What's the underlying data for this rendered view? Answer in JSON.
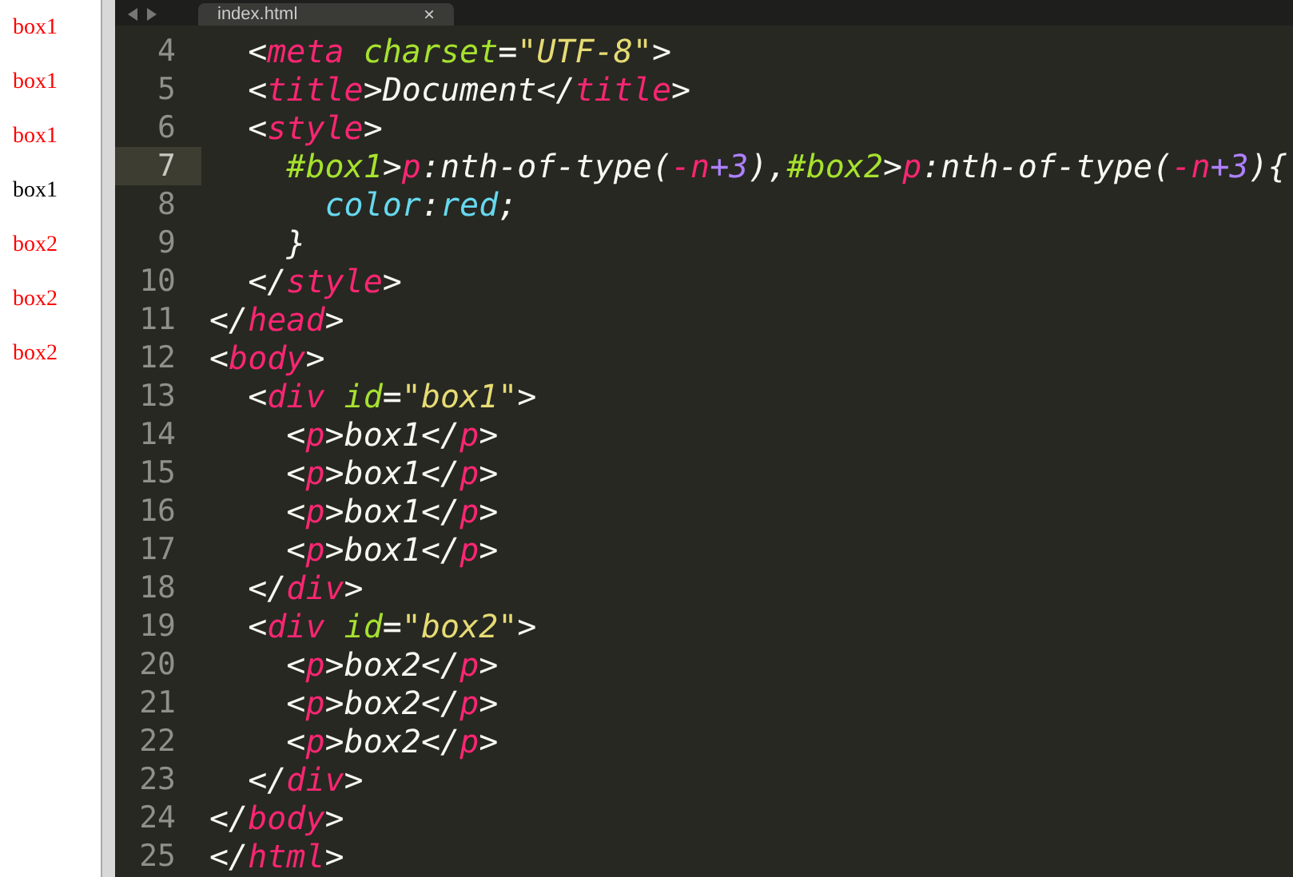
{
  "preview": {
    "paragraphs": [
      {
        "text": "box1",
        "color": "#ff0000"
      },
      {
        "text": "box1",
        "color": "#ff0000"
      },
      {
        "text": "box1",
        "color": "#ff0000"
      },
      {
        "text": "box1",
        "color": "#000000"
      },
      {
        "text": "box2",
        "color": "#ff0000"
      },
      {
        "text": "box2",
        "color": "#ff0000"
      },
      {
        "text": "box2",
        "color": "#ff0000"
      }
    ]
  },
  "editor": {
    "tab": {
      "label": "index.html",
      "close": "×"
    },
    "lines": [
      {
        "number": "4",
        "selected": false,
        "tokens": [
          {
            "kind": "punct",
            "text": "  <"
          },
          {
            "kind": "tag",
            "text": "meta"
          },
          {
            "kind": "attr",
            "text": " charset"
          },
          {
            "kind": "punct",
            "text": "="
          },
          {
            "kind": "string",
            "text": "\"UTF-8\""
          },
          {
            "kind": "punct",
            "text": ">"
          }
        ]
      },
      {
        "number": "5",
        "selected": false,
        "tokens": [
          {
            "kind": "punct",
            "text": "  <"
          },
          {
            "kind": "tag",
            "text": "title"
          },
          {
            "kind": "punct",
            "text": ">Document</"
          },
          {
            "kind": "tag",
            "text": "title"
          },
          {
            "kind": "punct",
            "text": ">"
          }
        ]
      },
      {
        "number": "6",
        "selected": false,
        "tokens": [
          {
            "kind": "punct",
            "text": "  <"
          },
          {
            "kind": "tag",
            "text": "style"
          },
          {
            "kind": "punct",
            "text": ">"
          }
        ]
      },
      {
        "number": "7",
        "selected": true,
        "tokens": [
          {
            "kind": "attr",
            "text": "    #box1"
          },
          {
            "kind": "punct",
            "text": ">"
          },
          {
            "kind": "tag",
            "text": "p"
          },
          {
            "kind": "punct",
            "text": ":nth-of-type("
          },
          {
            "kind": "tag",
            "text": "-n"
          },
          {
            "kind": "number",
            "text": "+3"
          },
          {
            "kind": "punct",
            "text": "),"
          },
          {
            "kind": "attr",
            "text": "#box2"
          },
          {
            "kind": "punct",
            "text": ">"
          },
          {
            "kind": "tag",
            "text": "p"
          },
          {
            "kind": "punct",
            "text": ":nth-of-type("
          },
          {
            "kind": "tag",
            "text": "-n"
          },
          {
            "kind": "number",
            "text": "+3"
          },
          {
            "kind": "punct",
            "text": "){"
          }
        ]
      },
      {
        "number": "8",
        "selected": false,
        "tokens": [
          {
            "kind": "property",
            "text": "      color"
          },
          {
            "kind": "punct",
            "text": ":"
          },
          {
            "kind": "property",
            "text": "red"
          },
          {
            "kind": "punct",
            "text": ";"
          }
        ]
      },
      {
        "number": "9",
        "selected": false,
        "tokens": [
          {
            "kind": "punct",
            "text": "    }"
          }
        ]
      },
      {
        "number": "10",
        "selected": false,
        "tokens": [
          {
            "kind": "punct",
            "text": "  </"
          },
          {
            "kind": "tag",
            "text": "style"
          },
          {
            "kind": "punct",
            "text": ">"
          }
        ]
      },
      {
        "number": "11",
        "selected": false,
        "tokens": [
          {
            "kind": "punct",
            "text": "</"
          },
          {
            "kind": "tag",
            "text": "head"
          },
          {
            "kind": "punct",
            "text": ">"
          }
        ]
      },
      {
        "number": "12",
        "selected": false,
        "tokens": [
          {
            "kind": "punct",
            "text": "<"
          },
          {
            "kind": "tag",
            "text": "body"
          },
          {
            "kind": "punct",
            "text": ">"
          }
        ]
      },
      {
        "number": "13",
        "selected": false,
        "tokens": [
          {
            "kind": "punct",
            "text": "  <"
          },
          {
            "kind": "tag",
            "text": "div"
          },
          {
            "kind": "attr",
            "text": " id"
          },
          {
            "kind": "punct",
            "text": "="
          },
          {
            "kind": "string",
            "text": "\"box1\""
          },
          {
            "kind": "punct",
            "text": ">"
          }
        ]
      },
      {
        "number": "14",
        "selected": false,
        "tokens": [
          {
            "kind": "punct",
            "text": "    <"
          },
          {
            "kind": "tag",
            "text": "p"
          },
          {
            "kind": "punct",
            "text": ">box1</"
          },
          {
            "kind": "tag",
            "text": "p"
          },
          {
            "kind": "punct",
            "text": ">"
          }
        ]
      },
      {
        "number": "15",
        "selected": false,
        "tokens": [
          {
            "kind": "punct",
            "text": "    <"
          },
          {
            "kind": "tag",
            "text": "p"
          },
          {
            "kind": "punct",
            "text": ">box1</"
          },
          {
            "kind": "tag",
            "text": "p"
          },
          {
            "kind": "punct",
            "text": ">"
          }
        ]
      },
      {
        "number": "16",
        "selected": false,
        "tokens": [
          {
            "kind": "punct",
            "text": "    <"
          },
          {
            "kind": "tag",
            "text": "p"
          },
          {
            "kind": "punct",
            "text": ">box1</"
          },
          {
            "kind": "tag",
            "text": "p"
          },
          {
            "kind": "punct",
            "text": ">"
          }
        ]
      },
      {
        "number": "17",
        "selected": false,
        "tokens": [
          {
            "kind": "punct",
            "text": "    <"
          },
          {
            "kind": "tag",
            "text": "p"
          },
          {
            "kind": "punct",
            "text": ">box1</"
          },
          {
            "kind": "tag",
            "text": "p"
          },
          {
            "kind": "punct",
            "text": ">"
          }
        ]
      },
      {
        "number": "18",
        "selected": false,
        "tokens": [
          {
            "kind": "punct",
            "text": "  </"
          },
          {
            "kind": "tag",
            "text": "div"
          },
          {
            "kind": "punct",
            "text": ">"
          }
        ]
      },
      {
        "number": "19",
        "selected": false,
        "tokens": [
          {
            "kind": "punct",
            "text": "  <"
          },
          {
            "kind": "tag",
            "text": "div"
          },
          {
            "kind": "attr",
            "text": " id"
          },
          {
            "kind": "punct",
            "text": "="
          },
          {
            "kind": "string",
            "text": "\"box2\""
          },
          {
            "kind": "punct",
            "text": ">"
          }
        ]
      },
      {
        "number": "20",
        "selected": false,
        "tokens": [
          {
            "kind": "punct",
            "text": "    <"
          },
          {
            "kind": "tag",
            "text": "p"
          },
          {
            "kind": "punct",
            "text": ">box2</"
          },
          {
            "kind": "tag",
            "text": "p"
          },
          {
            "kind": "punct",
            "text": ">"
          }
        ]
      },
      {
        "number": "21",
        "selected": false,
        "tokens": [
          {
            "kind": "punct",
            "text": "    <"
          },
          {
            "kind": "tag",
            "text": "p"
          },
          {
            "kind": "punct",
            "text": ">box2</"
          },
          {
            "kind": "tag",
            "text": "p"
          },
          {
            "kind": "punct",
            "text": ">"
          }
        ]
      },
      {
        "number": "22",
        "selected": false,
        "tokens": [
          {
            "kind": "punct",
            "text": "    <"
          },
          {
            "kind": "tag",
            "text": "p"
          },
          {
            "kind": "punct",
            "text": ">box2</"
          },
          {
            "kind": "tag",
            "text": "p"
          },
          {
            "kind": "punct",
            "text": ">"
          }
        ]
      },
      {
        "number": "23",
        "selected": false,
        "tokens": [
          {
            "kind": "punct",
            "text": "  </"
          },
          {
            "kind": "tag",
            "text": "div"
          },
          {
            "kind": "punct",
            "text": ">"
          }
        ]
      },
      {
        "number": "24",
        "selected": false,
        "tokens": [
          {
            "kind": "punct",
            "text": "</"
          },
          {
            "kind": "tag",
            "text": "body"
          },
          {
            "kind": "punct",
            "text": ">"
          }
        ]
      },
      {
        "number": "25",
        "selected": false,
        "tokens": [
          {
            "kind": "punct",
            "text": "</"
          },
          {
            "kind": "tag",
            "text": "html"
          },
          {
            "kind": "punct",
            "text": ">"
          }
        ]
      }
    ]
  }
}
